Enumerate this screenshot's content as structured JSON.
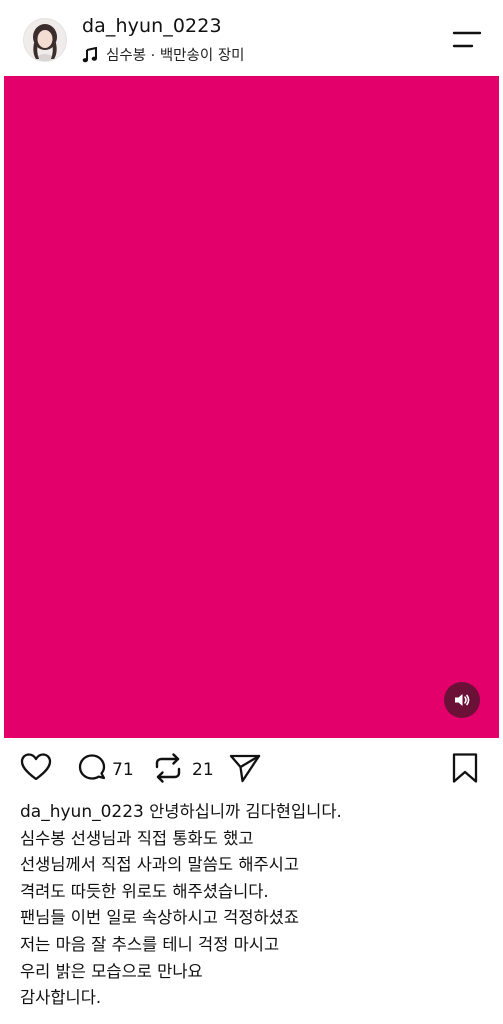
{
  "post": {
    "username": "da_hyun_0223",
    "music": "심수봉 · 백만송이 장미",
    "media_color": "#e4006a",
    "counts": {
      "comments": "71",
      "reposts": "21"
    },
    "caption": {
      "username": "da_hyun_0223",
      "first_line": "안녕하십니까 김다현입니다.",
      "lines": [
        "심수봉 선생님과 직접 통화도 했고",
        "선생님께서 직접 사과의 말씀도 해주시고",
        "격려도 따듯한 위로도 해주셨습니다.",
        "팬님들 이번 일로 속상하시고 걱정하셨죠",
        "저는 마음 잘 추스를 테니 걱정 마시고",
        "우리 밝은 모습으로 만나요",
        "감사합니다."
      ]
    }
  },
  "icons": {
    "music": "music-note-icon",
    "menu": "menu-icon",
    "sound": "speaker-icon",
    "like": "heart-icon",
    "comment": "comment-icon",
    "repost": "repost-icon",
    "share": "send-icon",
    "save": "bookmark-icon"
  }
}
